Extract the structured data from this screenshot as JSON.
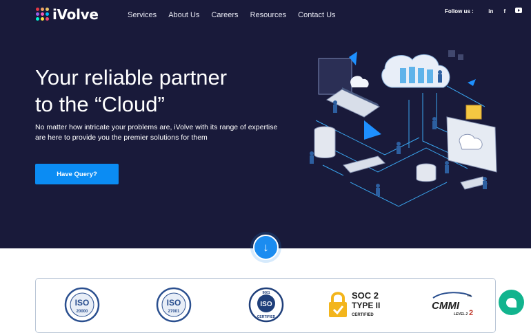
{
  "header": {
    "logo_text": "iVolve",
    "nav": [
      "Services",
      "About Us",
      "Careers",
      "Resources",
      "Contact Us"
    ],
    "follow_label": "Follow us :",
    "social": [
      {
        "icon": "linkedin-icon",
        "glyph": "in"
      },
      {
        "icon": "facebook-icon",
        "glyph": "f"
      },
      {
        "icon": "youtube-icon",
        "glyph": "▶"
      }
    ]
  },
  "hero": {
    "headline_line1": "Your reliable partner",
    "headline_line2": "to the “Cloud”",
    "subtext": "No matter how intricate your problems are, iVolve with its range of expertise are here to provide you the premier solutions for them",
    "cta_label": "Have Query?",
    "scroll_icon": "arrow-down-icon"
  },
  "certifications": [
    {
      "name": "iso-20000-badge",
      "title": "ISO",
      "number": "20000",
      "ring": "IT Service Management",
      "foot": "Certified"
    },
    {
      "name": "iso-27001-badge",
      "title": "ISO",
      "number": "27001",
      "ring": "Information Security Management",
      "foot": "Certified"
    },
    {
      "name": "iso-9001-badge",
      "title": "ISO",
      "number": "9001",
      "ring": "",
      "foot": "CERTIFIED"
    },
    {
      "name": "soc2-badge",
      "title": "SOC 2",
      "number": "TYPE II",
      "ring": "",
      "foot": "CERTIFIED"
    },
    {
      "name": "cmmi-badge",
      "title": "CMMI",
      "number": "LEVEL 2",
      "ring": "",
      "foot": "SM"
    }
  ],
  "colors": {
    "hero_bg": "#191a3a",
    "accent": "#0b8cf3",
    "chat": "#12b48e",
    "badge_blue": "#2a4f8f",
    "soc_gold": "#f3b51c"
  },
  "chat_icon": "chat-bubble-icon"
}
